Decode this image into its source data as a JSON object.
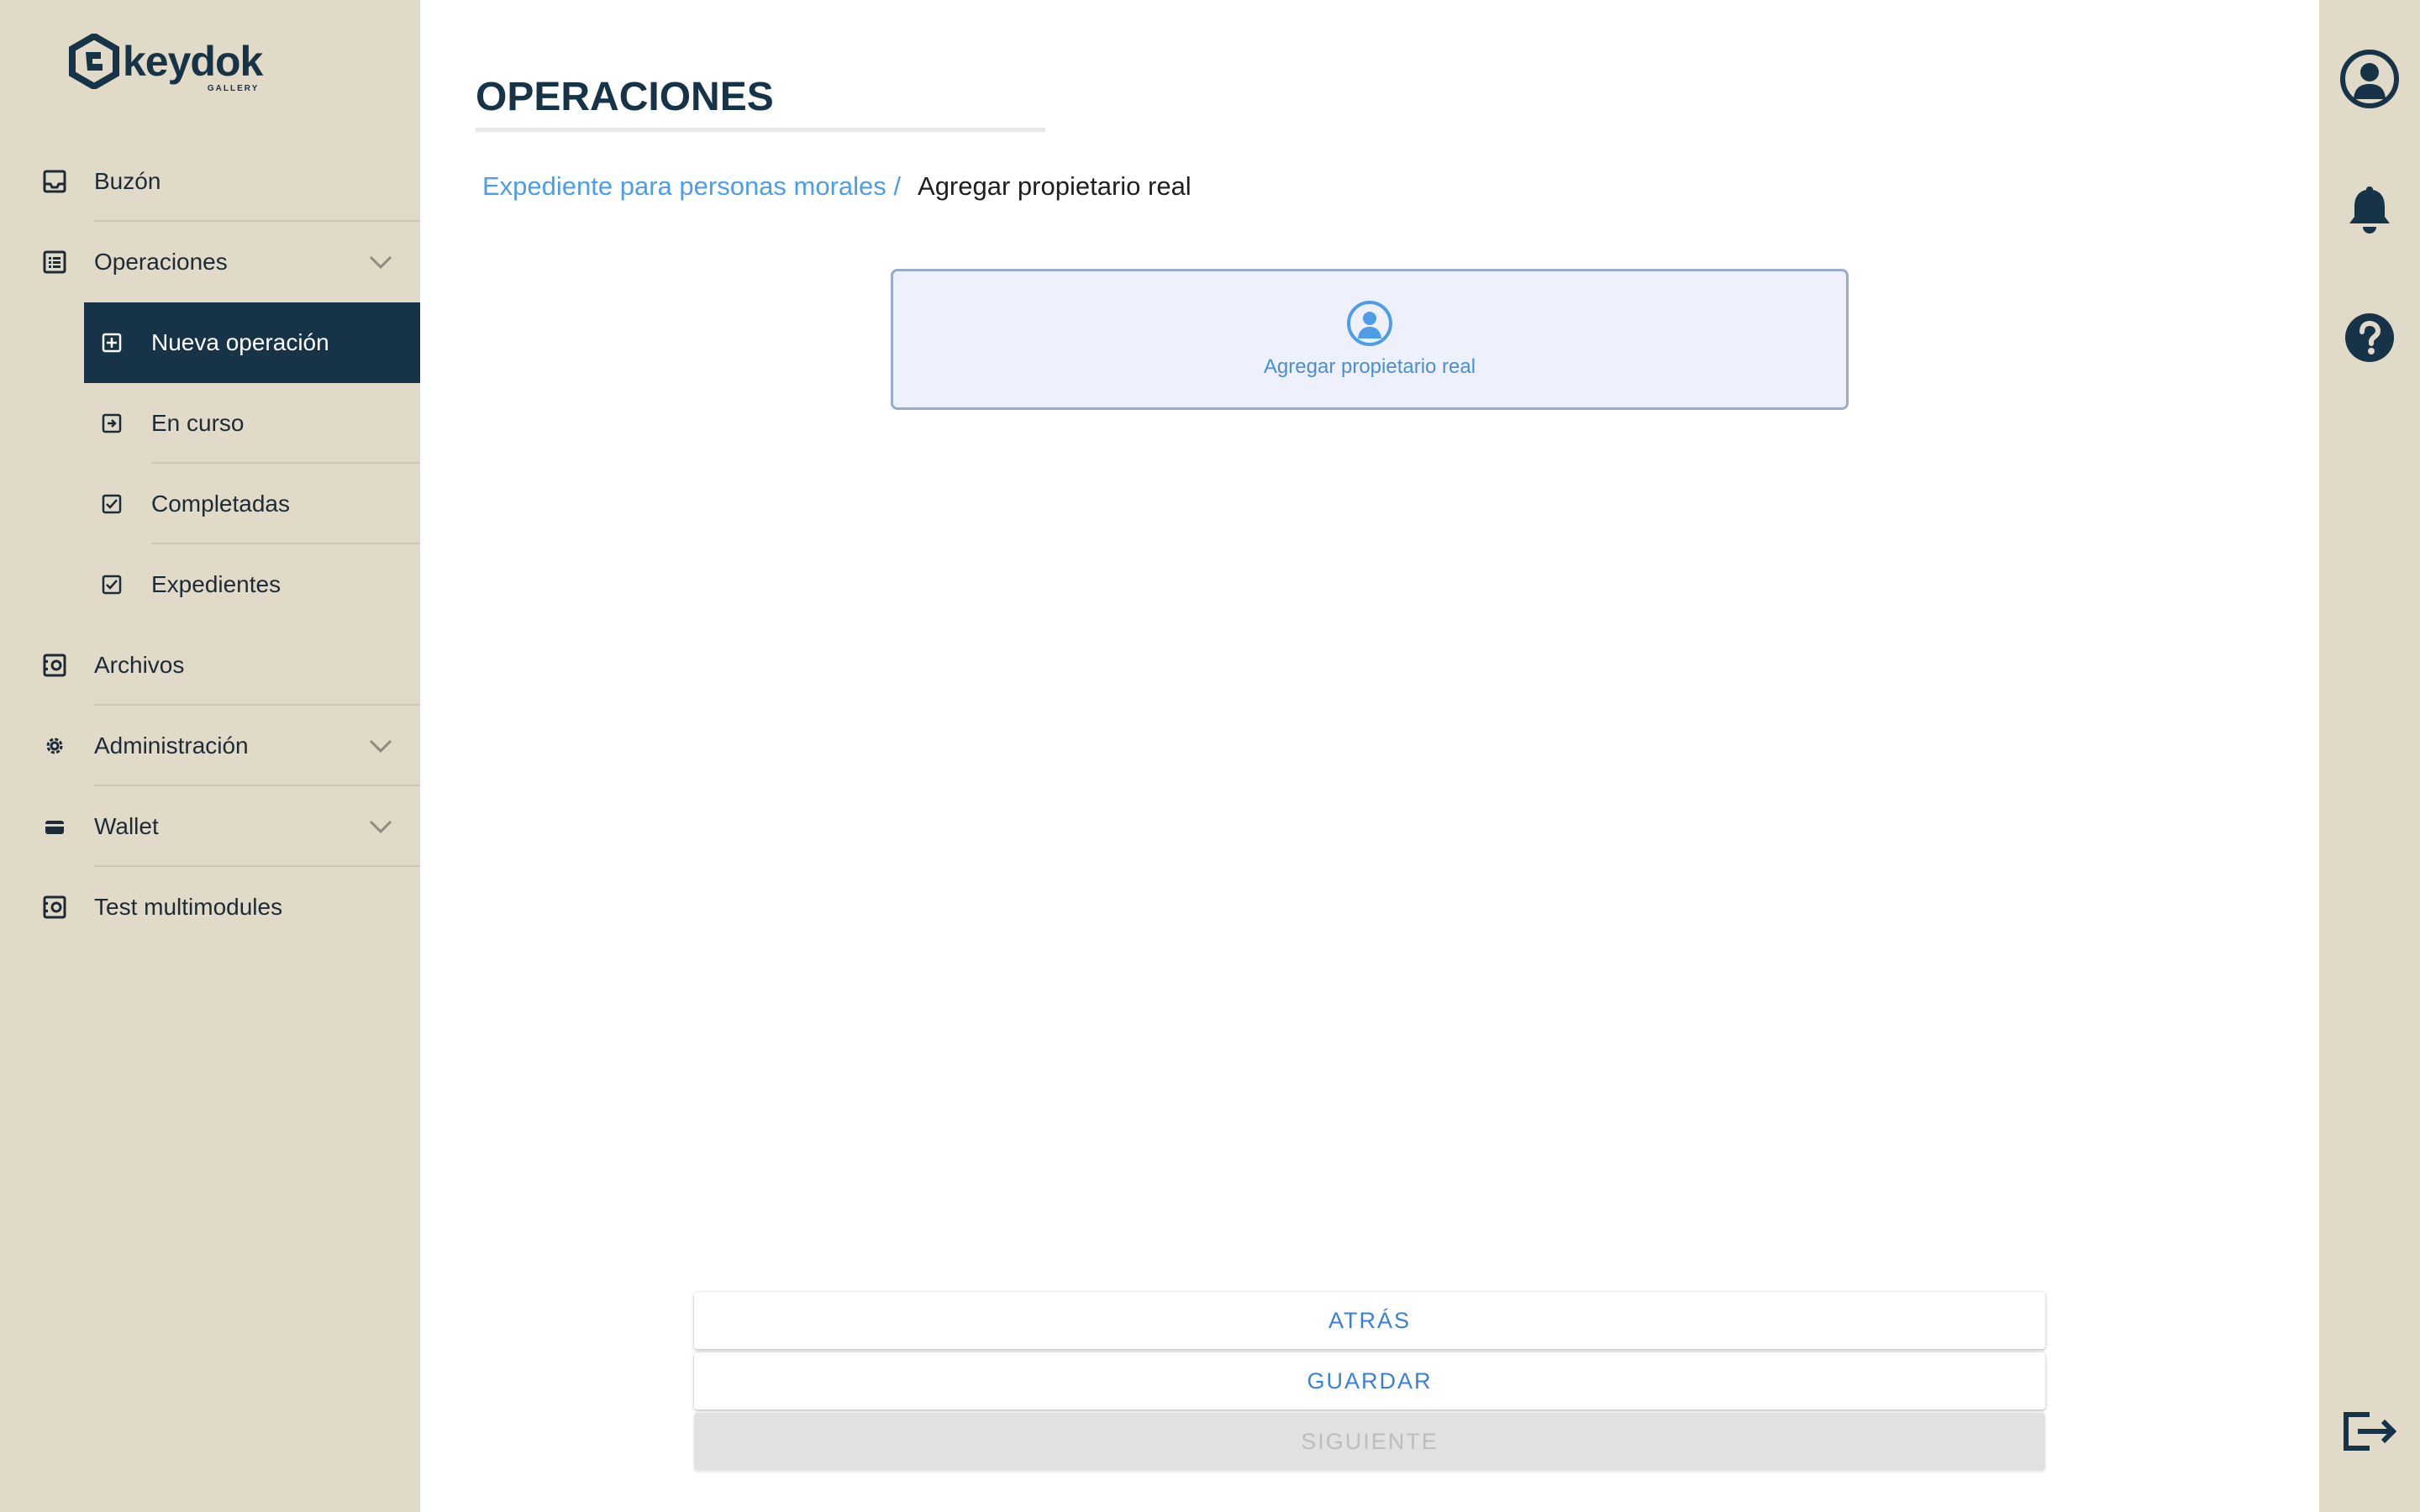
{
  "brand": {
    "name": "keydok",
    "subtitle": "GALLERY",
    "color": "#173348"
  },
  "sidebar": {
    "items": [
      {
        "label": "Buzón",
        "icon": "inbox-icon"
      },
      {
        "label": "Operaciones",
        "icon": "list-icon",
        "expandable": true,
        "expanded": true
      },
      {
        "label": "Nueva operación",
        "icon": "plus-square-icon",
        "sub": true,
        "active": true
      },
      {
        "label": "En curso",
        "icon": "arrow-square-icon",
        "sub": true
      },
      {
        "label": "Completadas",
        "icon": "check-square-icon",
        "sub": true
      },
      {
        "label": "Expedientes",
        "icon": "check-square-icon",
        "sub": true
      },
      {
        "label": "Archivos",
        "icon": "vault-icon"
      },
      {
        "label": "Administración",
        "icon": "gear-icon",
        "expandable": true
      },
      {
        "label": "Wallet",
        "icon": "wallet-icon",
        "expandable": true
      },
      {
        "label": "Test multimodules",
        "icon": "vault-icon"
      }
    ]
  },
  "header": {
    "title": "OPERACIONES"
  },
  "breadcrumb": {
    "parent": "Expediente para personas morales /",
    "current": "Agregar propietario real"
  },
  "card": {
    "label": "Agregar propietario real",
    "icon": "person-circle-icon"
  },
  "actions": {
    "back_label": "ATRÁS",
    "save_label": "GUARDAR",
    "next_label": "SIGUIENTE"
  },
  "rail": {
    "buttons": [
      "profile-icon",
      "bell-icon",
      "help-icon",
      "logout-icon"
    ]
  },
  "colors": {
    "sidebar_bg": "#e2dac9",
    "active_bg": "#173348",
    "link": "#4e9de8",
    "button_text": "#3b7fd9"
  }
}
